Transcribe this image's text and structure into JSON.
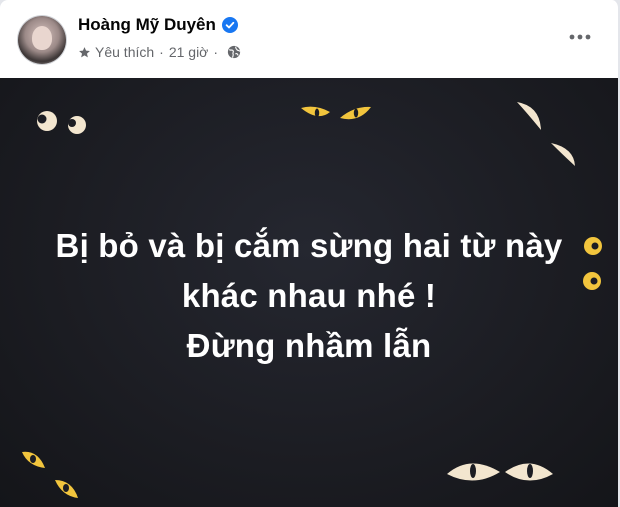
{
  "post": {
    "author_name": "Hoàng Mỹ Duyên",
    "relationship_label": "Yêu thích",
    "separator": "·",
    "time_ago": "21 giờ",
    "icons": {
      "verified": "verified-badge-icon",
      "favorite": "star-icon",
      "audience": "globe-icon",
      "more": "more-options-icon"
    },
    "image_text": {
      "line1": "Bị bỏ và bị cắm sừng hai từ này",
      "line2": "khác nhau nhé !",
      "line3": "Đừng nhầm lẫn"
    }
  },
  "colors": {
    "verified_blue": "#1877f2",
    "secondary_text": "#65676b",
    "image_background": "#1c1d23",
    "eye_yellow": "#f2c53d",
    "eye_cream": "#f3e6cf"
  }
}
